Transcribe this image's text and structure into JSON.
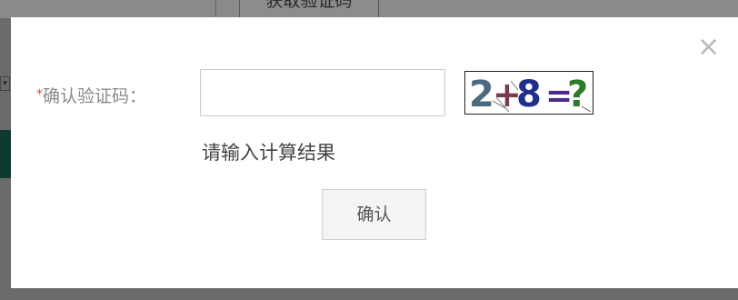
{
  "background": {
    "get_code_label": "获取验证码"
  },
  "dialog": {
    "close_glyph": "×",
    "required_mark": "*",
    "label": "确认验证码：",
    "input_value": "",
    "input_placeholder": "",
    "captcha": {
      "text": "2+8=?",
      "chars": [
        {
          "char": "2",
          "color": "#4a6a7e"
        },
        {
          "char": "+",
          "color": "#7b3b4f"
        },
        {
          "char": "8",
          "color": "#1f2f8a"
        },
        {
          "char": "=",
          "color": "#4b2a8a"
        },
        {
          "char": "?",
          "color": "#2f7a2a"
        }
      ]
    },
    "hint": "请输入计算结果",
    "confirm_label": "确认"
  },
  "colors": {
    "overlay": "#6b6b6b",
    "dialog_bg": "#ffffff",
    "required": "#e34a4a",
    "label": "#8a8a8a"
  }
}
